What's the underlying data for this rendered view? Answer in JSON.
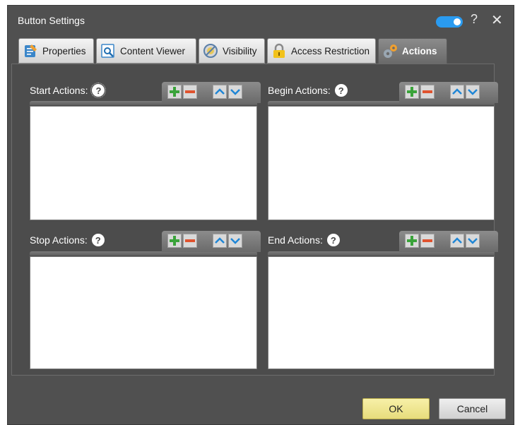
{
  "window": {
    "title": "Button Settings",
    "help_glyph": "?",
    "close_glyph": "✕"
  },
  "tabs": [
    {
      "label": "Properties",
      "icon": "properties-icon"
    },
    {
      "label": "Content Viewer",
      "icon": "content-viewer-icon"
    },
    {
      "label": "Visibility",
      "icon": "visibility-icon"
    },
    {
      "label": "Access Restriction",
      "icon": "lock-icon"
    },
    {
      "label": "Actions",
      "icon": "gears-icon",
      "active": true
    }
  ],
  "groups": [
    {
      "label": "Start Actions:",
      "help": "?"
    },
    {
      "label": "Begin Actions:",
      "help": "?"
    },
    {
      "label": "Stop Actions:",
      "help": "?"
    },
    {
      "label": "End Actions:",
      "help": "?"
    }
  ],
  "buttons": {
    "ok": "OK",
    "cancel": "Cancel"
  },
  "colors": {
    "accent_toggle": "#2a9bf0",
    "add_green": "#3aa33a",
    "remove_red": "#e0532f",
    "arrow_blue": "#1f86d6",
    "ok_yellow": "#eee392"
  }
}
